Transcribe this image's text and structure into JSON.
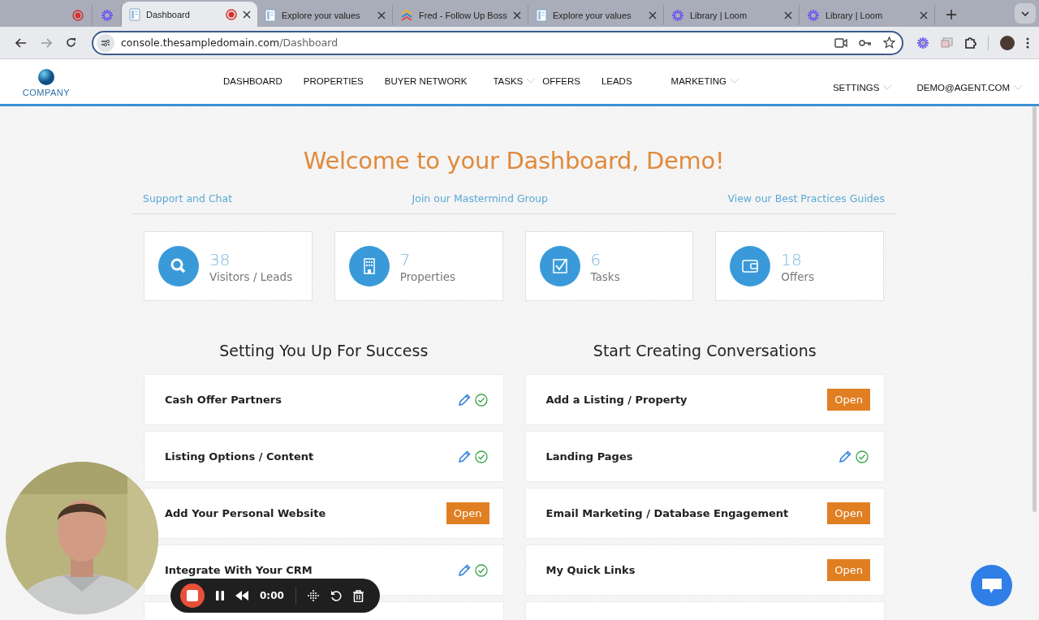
{
  "browser": {
    "tabs": [
      {
        "kind": "record",
        "selected": false
      },
      {
        "kind": "loom",
        "selected": false
      },
      {
        "kind": "doc",
        "title": "Dashboard",
        "selected": true,
        "recording": true
      },
      {
        "kind": "doc",
        "title": "Explore your values",
        "selected": false
      },
      {
        "kind": "fub",
        "title": "Fred - Follow Up Boss",
        "selected": false
      },
      {
        "kind": "doc",
        "title": "Explore your values",
        "selected": false
      },
      {
        "kind": "loom",
        "title": "Library | Loom",
        "selected": false
      },
      {
        "kind": "loom",
        "title": "Library | Loom",
        "selected": false
      }
    ],
    "url": {
      "host": "console.thesampledomain.com",
      "path": "/Dashboard"
    }
  },
  "site": {
    "logo": "COMPANY",
    "nav": [
      {
        "label": "DASHBOARD",
        "has_menu": false
      },
      {
        "label": "PROPERTIES",
        "has_menu": false
      },
      {
        "label": "BUYER NETWORK",
        "has_menu": false
      },
      {
        "label": "TASKS",
        "has_menu": true
      },
      {
        "label": "OFFERS",
        "has_menu": false
      },
      {
        "label": "LEADS",
        "has_menu": false
      },
      {
        "label": "MARKETING",
        "has_menu": true
      }
    ],
    "nav_right": [
      {
        "label": "SETTINGS",
        "has_menu": true
      },
      {
        "label": "DEMO@AGENT.COM",
        "has_menu": true
      }
    ]
  },
  "welcome": "Welcome to your Dashboard, Demo!",
  "links": [
    "Support and Chat",
    "Join our Mastermind Group",
    "View our Best Practices Guides"
  ],
  "stats": [
    {
      "kind": "search",
      "count": "38",
      "label": "Visitors / Leads"
    },
    {
      "kind": "building",
      "count": "7",
      "label": "Properties"
    },
    {
      "kind": "task",
      "count": "6",
      "label": "Tasks"
    },
    {
      "kind": "wallet",
      "count": "18",
      "label": "Offers"
    }
  ],
  "sections": [
    {
      "title": "Setting You Up For Success",
      "rows": [
        {
          "kind": "done",
          "label": "Cash Offer Partners"
        },
        {
          "kind": "done",
          "label": "Listing Options / Content"
        },
        {
          "kind": "open",
          "label": "Add Your Personal Website",
          "button": "Open"
        },
        {
          "kind": "done",
          "label": "Integrate With Your CRM"
        },
        {
          "kind": "blank"
        }
      ]
    },
    {
      "title": "Start Creating Conversations",
      "rows": [
        {
          "kind": "open",
          "label": "Add a Listing / Property",
          "button": "Open"
        },
        {
          "kind": "done",
          "label": "Landing Pages"
        },
        {
          "kind": "open",
          "label": "Email Marketing / Database Engagement",
          "button": "Open"
        },
        {
          "kind": "open",
          "label": "My Quick Links",
          "button": "Open"
        },
        {
          "kind": "blank"
        }
      ]
    }
  ],
  "recorder": {
    "time": "0:00"
  }
}
